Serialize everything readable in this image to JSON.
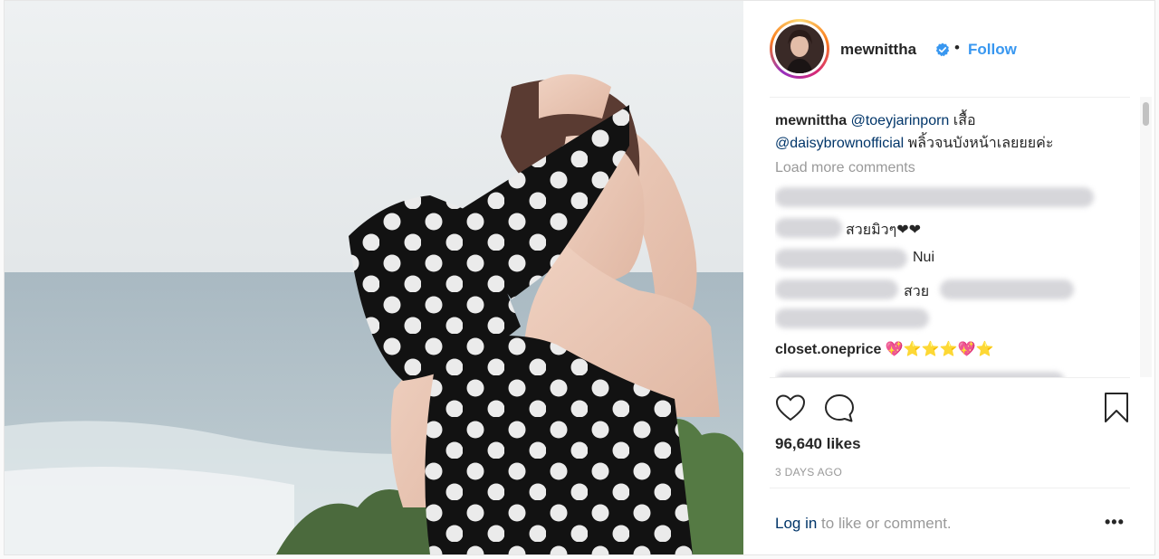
{
  "post": {
    "username": "mewnittha",
    "separator": "•",
    "follow_label": "Follow",
    "photo_description_icon": "photo-image"
  },
  "caption": {
    "username": "mewnittha",
    "mention1": "@toeyjarinporn",
    "text1": " เสื้อ",
    "mention2": "@daisybrownofficial",
    "text2": " พลิ้วจนบังหน้าเลยยยค่ะ"
  },
  "load_more": "Load more comments",
  "comments": [
    {
      "visible_text": ""
    },
    {
      "visible_text": "สวยมิวๆ❤❤"
    },
    {
      "visible_text": "Nui"
    },
    {
      "visible_text": "สวย"
    },
    {
      "visible_text": ""
    },
    {
      "username": "closet.oneprice",
      "visible_text": "💖⭐⭐⭐💖⭐"
    },
    {
      "visible_text": ""
    }
  ],
  "likes": "96,640 likes",
  "timestamp": "3 DAYS AGO",
  "footer": {
    "login_link": "Log in",
    "login_rest": " to like or comment.",
    "more_label": "•••"
  },
  "colors": {
    "link_blue": "#3897f0",
    "mention_navy": "#003569",
    "muted": "#999999",
    "verified_blue": "#3897f0"
  }
}
